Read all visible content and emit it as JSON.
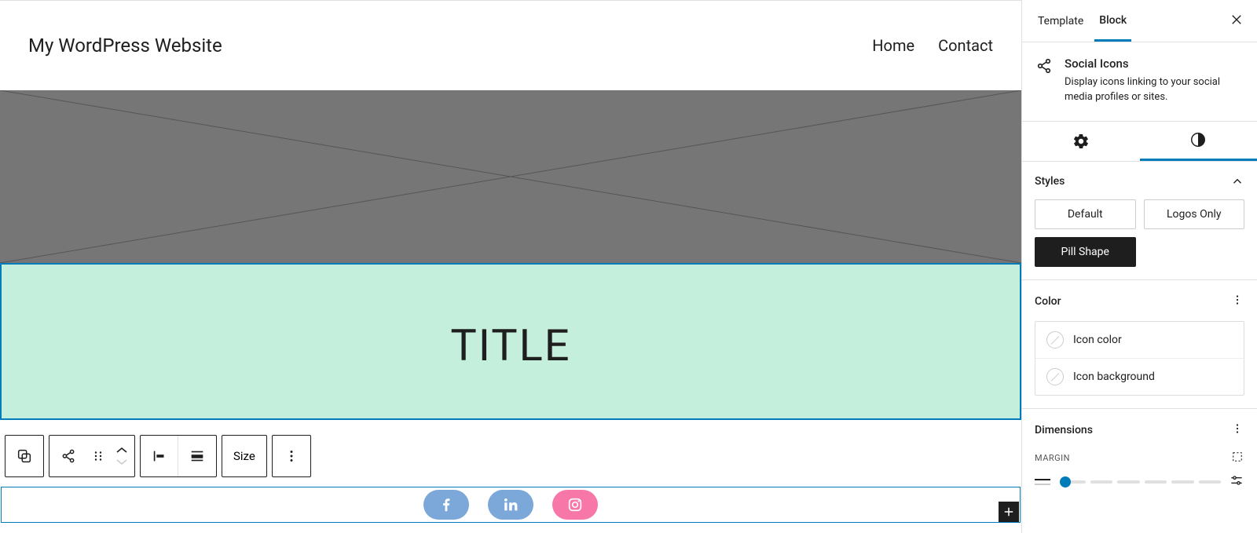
{
  "site": {
    "title": "My WordPress Website"
  },
  "nav": {
    "home": "Home",
    "contact": "Contact"
  },
  "content": {
    "heading": "TITLE"
  },
  "toolbar": {
    "size": "Size"
  },
  "social": {
    "facebook": {
      "color": "#7ba7d9"
    },
    "linkedin": {
      "color": "#7ba7d9"
    },
    "instagram": {
      "color": "#f778a8"
    }
  },
  "sidebar": {
    "tabs": {
      "template": "Template",
      "block": "Block"
    },
    "block": {
      "name": "Social Icons",
      "description": "Display icons linking to your social media profiles or sites."
    },
    "styles": {
      "title": "Styles",
      "options": {
        "default": "Default",
        "logos_only": "Logos Only",
        "pill_shape": "Pill Shape"
      }
    },
    "color": {
      "title": "Color",
      "icon_color": "Icon color",
      "icon_bg": "Icon background"
    },
    "dimensions": {
      "title": "Dimensions",
      "margin": "MARGIN"
    }
  }
}
